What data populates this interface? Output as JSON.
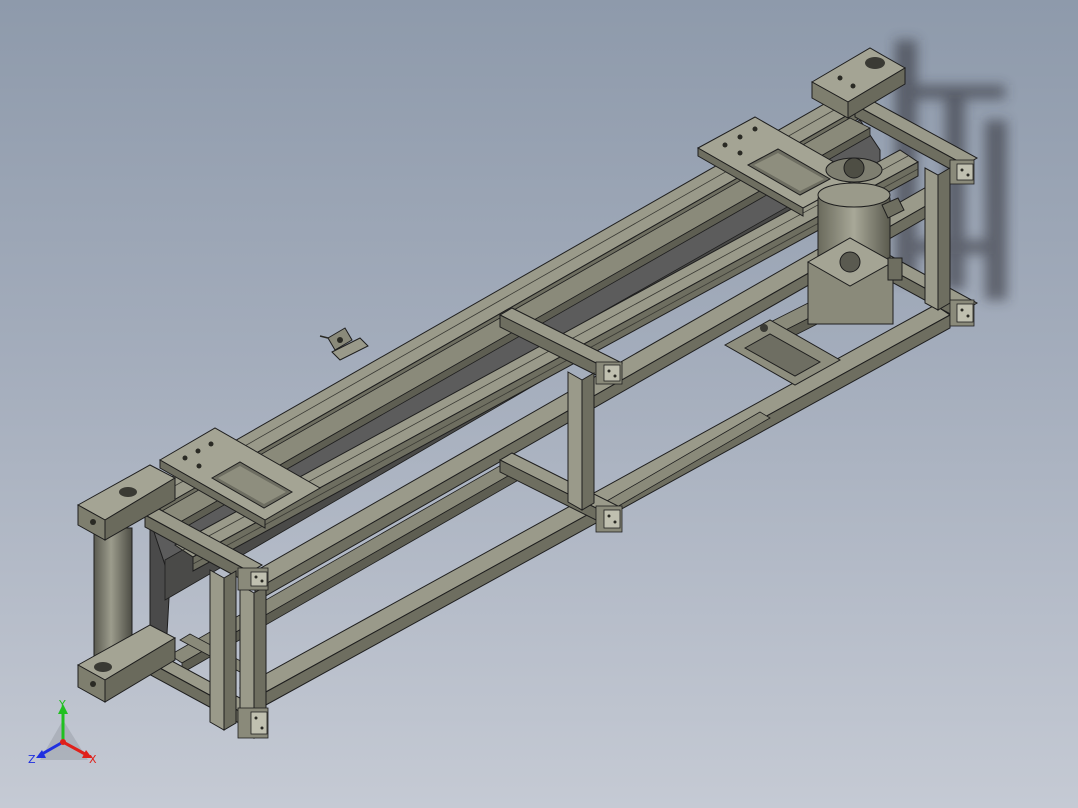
{
  "viewport": {
    "background_top": "#8e9aab",
    "background_bottom": "#c5cad4",
    "model": "belt-conveyor-assembly"
  },
  "colors": {
    "frame_top": "#9a9a8a",
    "frame_side": "#6e6e60",
    "frame_dark": "#4e4e44",
    "belt": "#5c5c5c",
    "edge": "#1e1e1e"
  },
  "triad": {
    "x_label": "X",
    "y_label": "Y",
    "z_label": "Z",
    "x_color": "#e0201a",
    "y_color": "#20c020",
    "z_color": "#2030e0"
  }
}
